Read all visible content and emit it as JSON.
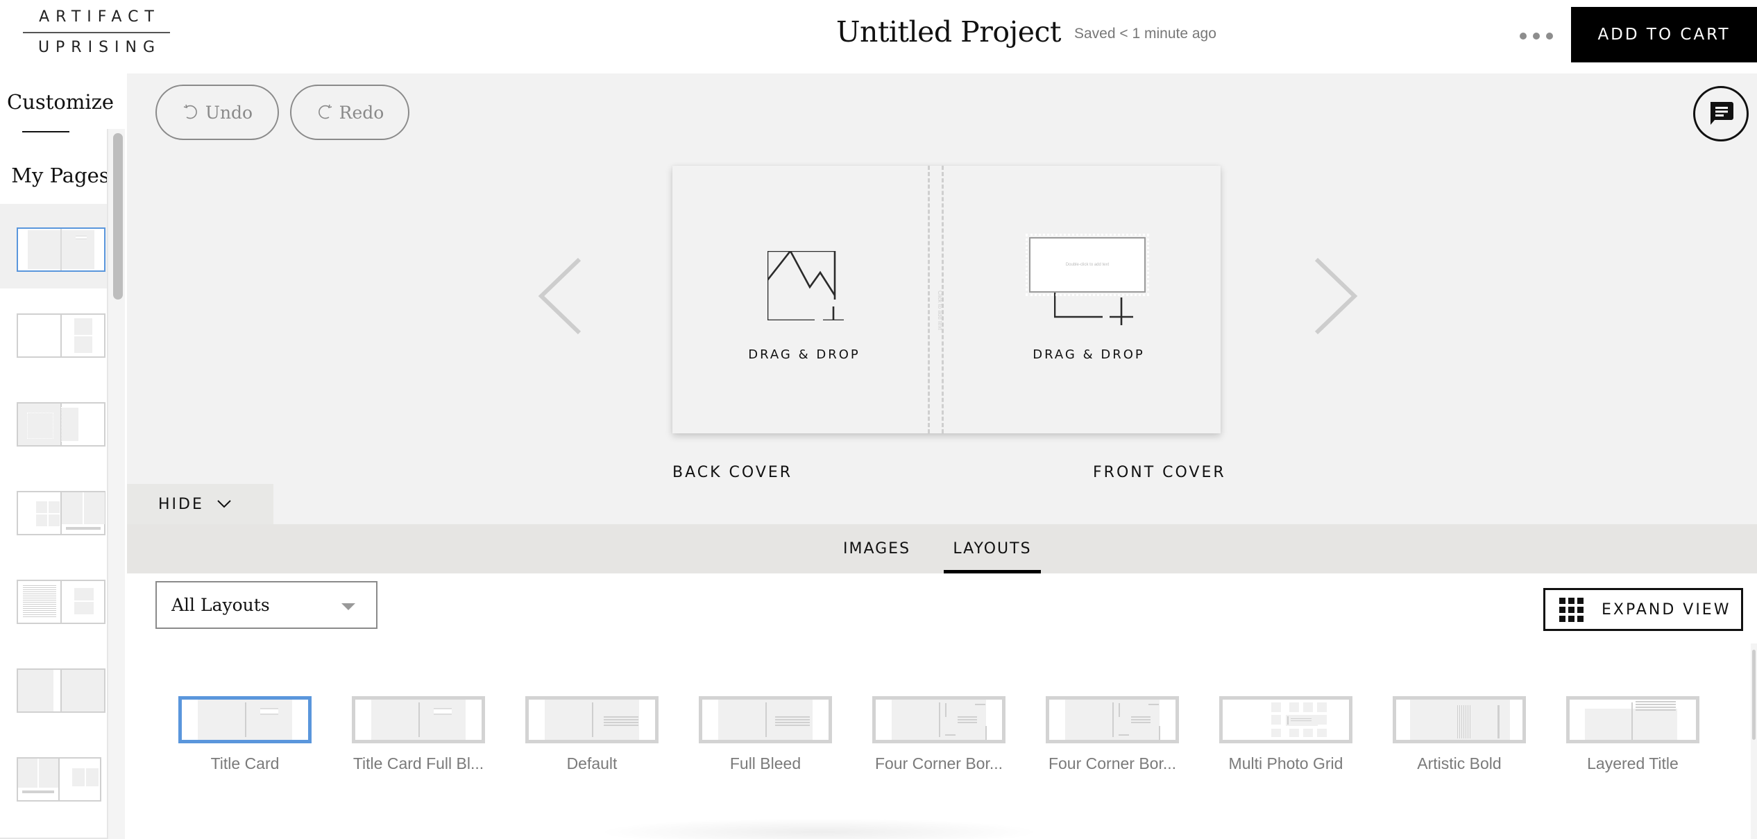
{
  "header": {
    "logo_line1": "ARTIFACT",
    "logo_line2": "UPRISING",
    "project_title": "Untitled Project",
    "saved_status": "Saved < 1 minute ago",
    "more_icon": "more-horizontal-icon",
    "add_to_cart_label": "ADD TO CART"
  },
  "sidebar": {
    "customize_label": "Customize",
    "my_pages_label": "My Pages",
    "pages": [
      {
        "layout": "title-card",
        "selected": true
      },
      {
        "layout": "two-stacked-right",
        "selected": false
      },
      {
        "layout": "full-left-tall-right",
        "selected": false
      },
      {
        "layout": "grid-left-caption-right",
        "selected": false
      },
      {
        "layout": "text-left-stacked-right",
        "selected": false
      },
      {
        "layout": "full-bleed-both",
        "selected": false
      },
      {
        "layout": "caption-left-pair-right",
        "selected": false
      }
    ]
  },
  "toolbar": {
    "undo_label": "Undo",
    "redo_label": "Redo",
    "chat_icon": "chat-icon"
  },
  "spread": {
    "left_drop_label": "DRAG & DROP",
    "right_drop_label": "DRAG & DROP",
    "spine_placeholder": "Click to add text",
    "text_box_placeholder": "Double-click to add text",
    "back_cover_label": "BACK COVER",
    "front_cover_label": "FRONT COVER"
  },
  "panel": {
    "hide_label": "HIDE",
    "tabs": [
      {
        "label": "IMAGES",
        "active": false
      },
      {
        "label": "LAYOUTS",
        "active": true
      }
    ],
    "filter_selected": "All Layouts",
    "expand_view_label": "EXPAND VIEW"
  },
  "layouts": [
    {
      "name": "Title Card",
      "selected": true
    },
    {
      "name": "Title Card Full Bl...",
      "selected": false
    },
    {
      "name": "Default",
      "selected": false
    },
    {
      "name": "Full Bleed",
      "selected": false
    },
    {
      "name": "Four Corner Bor...",
      "selected": false
    },
    {
      "name": "Four Corner Bor...",
      "selected": false
    },
    {
      "name": "Multi Photo Grid",
      "selected": false
    },
    {
      "name": "Artistic Bold",
      "selected": false
    },
    {
      "name": "Layered Title",
      "selected": false
    }
  ],
  "colors": {
    "accent_selected": "#5a96dc",
    "cart_button": "#000000",
    "canvas_bg": "#f2f2f2",
    "tabs_bg": "#e6e5e3"
  }
}
